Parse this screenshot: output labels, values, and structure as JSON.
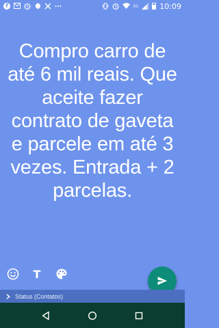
{
  "status_bar": {
    "time": "10:09",
    "network_label": "3G",
    "icons": [
      "facebook-icon",
      "gmail-icon",
      "alarm-icon",
      "hangouts-icon",
      "no-signal-icon",
      "more-icon",
      "vibrate-icon",
      "alarm-icon",
      "wifi-icon",
      "signal-icon",
      "battery-icon"
    ]
  },
  "status_post": {
    "text": "Compro carro de até 6 mil reais. Que aceite fazer contrato de gaveta e parcele em até 3 vezes. Entrada + 2 parcelas.",
    "background_color": "#6e93ec",
    "text_color": "#ffffff"
  },
  "toolbar": {
    "emoji_icon": "emoji-icon",
    "text_icon_label": "T",
    "palette_icon": "palette-icon"
  },
  "send_button": {
    "icon": "send-icon",
    "color": "#0e8c7a"
  },
  "recipient_bar": {
    "label": "Status (Contatos)"
  },
  "nav_bar": {
    "color": "#0b3e2e",
    "buttons": [
      "back-icon",
      "home-icon",
      "recent-apps-icon"
    ]
  }
}
